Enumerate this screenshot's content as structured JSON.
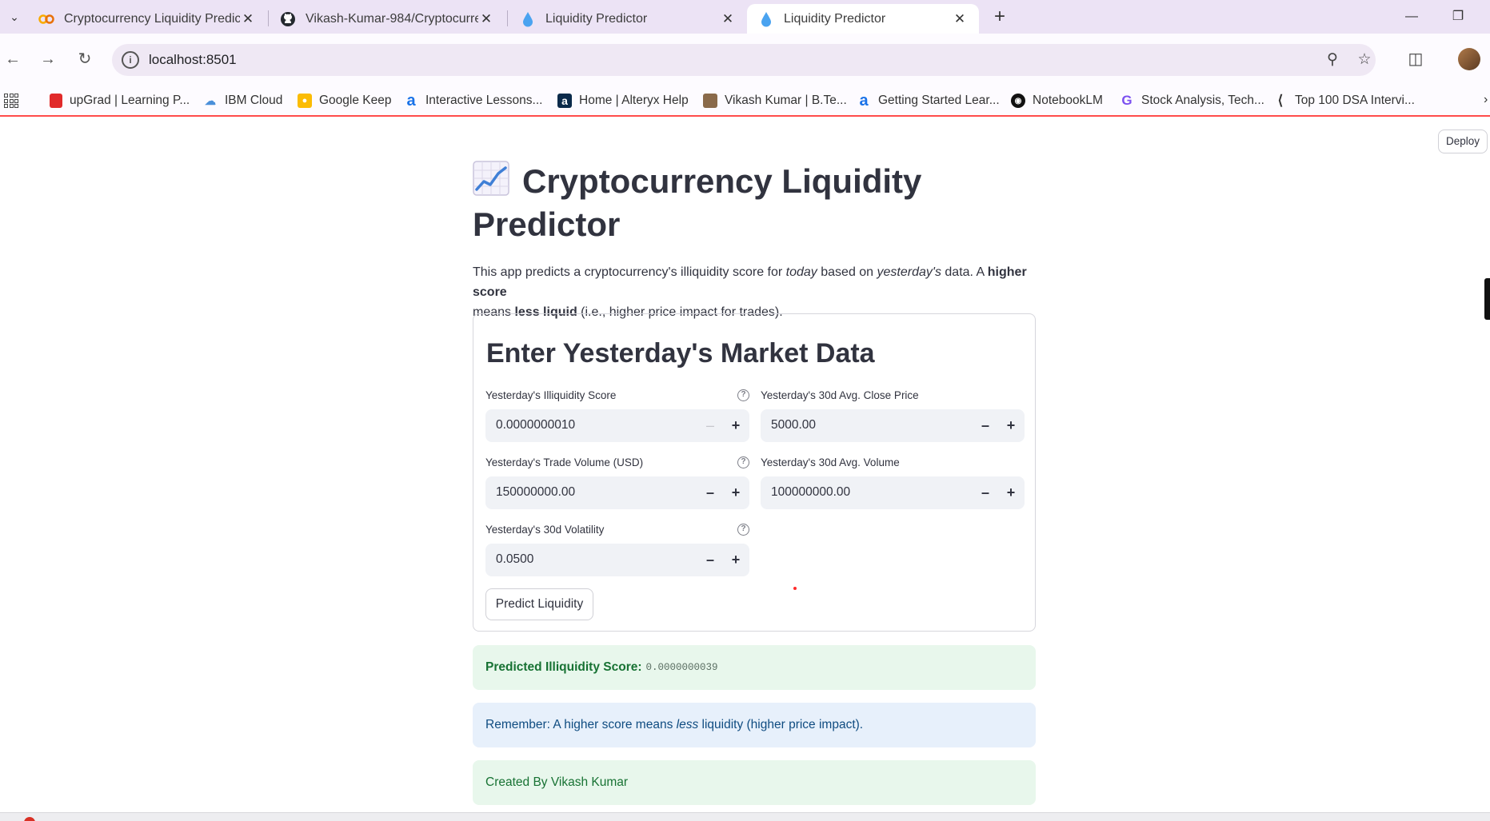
{
  "browser": {
    "tabs": [
      {
        "title": "Cryptocurrency Liquidity Predic",
        "icon": "colab-icon",
        "active": false
      },
      {
        "title": "Vikash-Kumar-984/Cryptocurre",
        "icon": "github-icon",
        "active": false
      },
      {
        "title": "Liquidity Predictor",
        "icon": "droplet-icon",
        "active": false
      },
      {
        "title": "Liquidity Predictor",
        "icon": "droplet-icon",
        "active": true
      }
    ],
    "url": "localhost:8501",
    "bookmarks": [
      {
        "label": "upGrad | Learning P...",
        "icon": "upgrad-icon"
      },
      {
        "label": "IBM Cloud",
        "icon": "cloud-icon"
      },
      {
        "label": "Google Keep",
        "icon": "keep-icon"
      },
      {
        "label": "Interactive Lessons...",
        "icon": "alteryx-icon"
      },
      {
        "label": "Home | Alteryx Help",
        "icon": "alteryx-a-icon"
      },
      {
        "label": "Vikash Kumar | B.Te...",
        "icon": "profile-icon"
      },
      {
        "label": "Getting Started Lear...",
        "icon": "alteryx-icon"
      },
      {
        "label": "NotebookLM",
        "icon": "notebooklm-icon"
      },
      {
        "label": "Stock Analysis, Tech...",
        "icon": "stock-icon"
      },
      {
        "label": "Top 100 DSA Intervi...",
        "icon": "dsa-icon"
      }
    ]
  },
  "app": {
    "deploy_label": "Deploy",
    "title": "Cryptocurrency Liquidity Predictor",
    "intro": {
      "p1": "This app predicts a cryptocurrency's illiquidity score for ",
      "today": "today",
      "p2": " based on ",
      "yesterday": "yesterday's",
      "p3": " data. A ",
      "higher_score": "higher score",
      "p4": " means ",
      "less_liquid": "less liquid",
      "p5": " (i.e., higher price impact for trades)."
    },
    "form": {
      "title": "Enter Yesterday's Market Data",
      "fields": {
        "illiquidity": {
          "label": "Yesterday's Illiquidity Score",
          "value": "0.0000000010"
        },
        "close_price": {
          "label": "Yesterday's 30d Avg. Close Price",
          "value": "5000.00"
        },
        "trade_volume": {
          "label": "Yesterday's Trade Volume (USD)",
          "value": "150000000.00"
        },
        "avg_volume": {
          "label": "Yesterday's 30d Avg. Volume",
          "value": "100000000.00"
        },
        "volatility": {
          "label": "Yesterday's 30d Volatility",
          "value": "0.0500"
        }
      },
      "button_label": "Predict Liquidity"
    },
    "result": {
      "label": "Predicted Illiquidity Score:",
      "value": "0.0000000039"
    },
    "reminder": {
      "p1": "Remember: A higher score means ",
      "less": "less",
      "p2": " liquidity (higher price impact)."
    },
    "credit": "Created By Vikash Kumar"
  },
  "colors": {
    "success_bg": "#e8f7ec",
    "success_text": "#177233",
    "info_bg": "#e7f0fb",
    "info_text": "#0f4c81",
    "accent_red": "#ff4b4b"
  }
}
